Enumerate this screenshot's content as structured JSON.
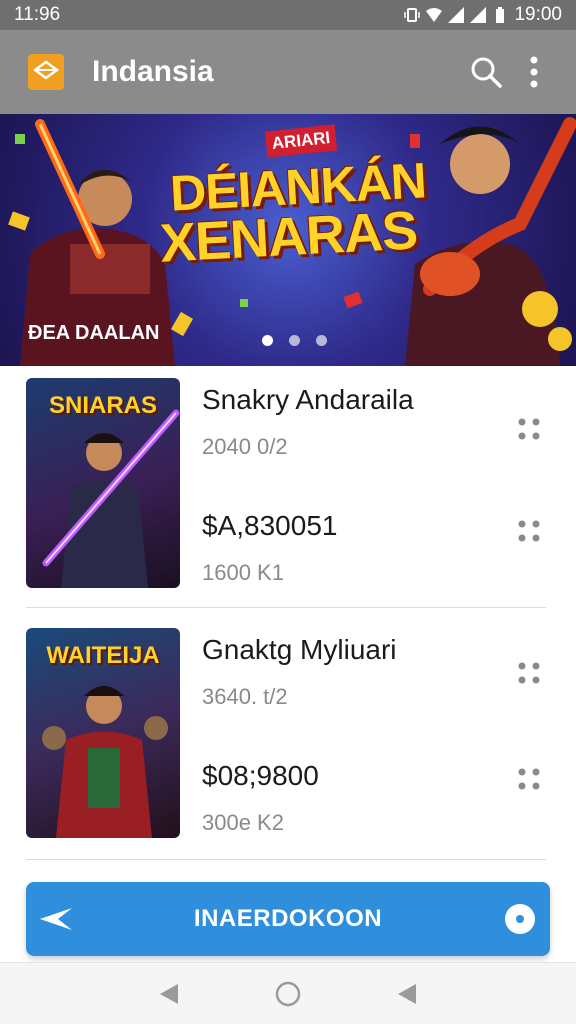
{
  "status_bar": {
    "time": "11:96",
    "clock": "19:00"
  },
  "app_bar": {
    "title": "Indansia"
  },
  "banner": {
    "tag": "ARIARI",
    "title_line1": "DÉIANKÁN",
    "title_line2": "XENARAS",
    "caption": "ÐEA DAALAN",
    "page_count": 3,
    "active_page": 1
  },
  "items": [
    {
      "thumb_title": "SNIARAS",
      "name": "Snakry Andaraila",
      "sub1": "2040 0/2",
      "price": "$A,830051",
      "sub2": "1600 K1"
    },
    {
      "thumb_title": "WAITEIJA",
      "name": "Gnaktg Myliuari",
      "sub1": "3640. t/2",
      "price": "$08;9800",
      "sub2": "300e K2"
    }
  ],
  "cta": {
    "label": "INAERDOKOON"
  },
  "colors": {
    "app_bar": "#8b8b8b",
    "status_bar": "#6f6f6f",
    "cta": "#2f8fdc",
    "logo": "#f0a020"
  }
}
